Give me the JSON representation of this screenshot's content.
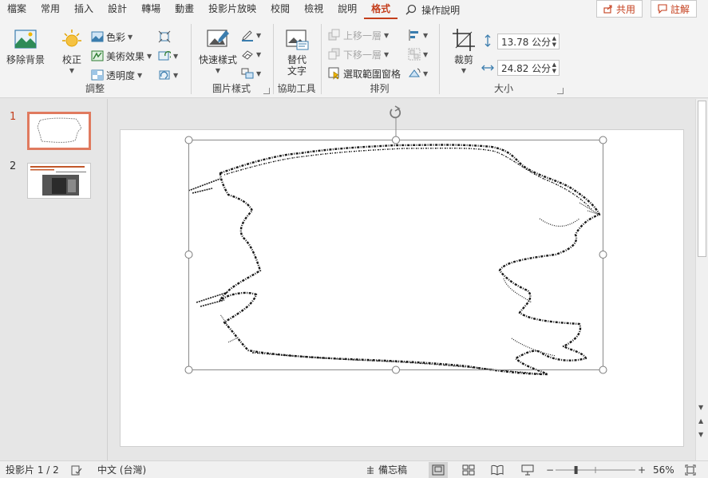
{
  "tabs": [
    "檔案",
    "常用",
    "插入",
    "設計",
    "轉場",
    "動畫",
    "投影片放映",
    "校閱",
    "檢視",
    "說明",
    "格式"
  ],
  "active_tab": "格式",
  "tell_me": "操作說明",
  "share": "共用",
  "comments": "註解",
  "adjust": {
    "remove_bg": "移除背景",
    "corrections": "校正",
    "color": "色彩",
    "artistic": "美術效果",
    "transparency": "透明度",
    "group_label": "調整"
  },
  "picture_styles": {
    "quick_styles": "快速樣式",
    "group_label": "圖片樣式"
  },
  "accessibility": {
    "alt_text_line1": "替代",
    "alt_text_line2": "文字",
    "group_label": "協助工具"
  },
  "arrange": {
    "bring_forward": "上移一層",
    "send_backward": "下移一層",
    "selection_pane": "選取範圍窗格",
    "group_label": "排列"
  },
  "size": {
    "crop": "裁剪",
    "height": "13.78 公分",
    "width": "24.82 公分",
    "group_label": "大小"
  },
  "slides": [
    {
      "number": "1",
      "active": true
    },
    {
      "number": "2",
      "active": false
    }
  ],
  "status": {
    "slide_info": "投影片 1 / 2",
    "language": "中文 (台灣)",
    "notes": "備忘稿",
    "zoom": "56%",
    "zoom_level": 0.56
  },
  "colors": {
    "accent": "#c43e1c"
  }
}
